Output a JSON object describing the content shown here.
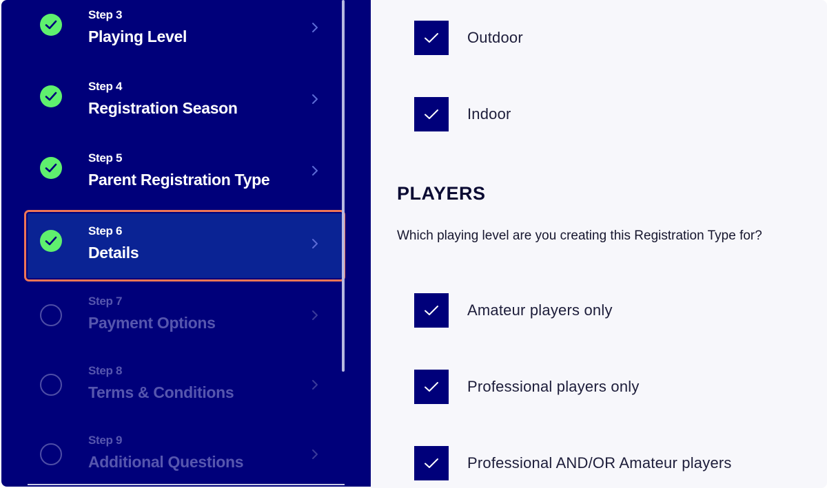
{
  "sidebar": {
    "steps": [
      {
        "num": "Step 3",
        "title": "Playing Level",
        "state": "done"
      },
      {
        "num": "Step 4",
        "title": "Registration Season",
        "state": "done"
      },
      {
        "num": "Step 5",
        "title": "Parent Registration Type",
        "state": "done"
      },
      {
        "num": "Step 6",
        "title": "Details",
        "state": "active"
      },
      {
        "num": "Step 7",
        "title": "Payment Options",
        "state": "pending"
      },
      {
        "num": "Step 8",
        "title": "Terms & Conditions",
        "state": "pending"
      },
      {
        "num": "Step 9",
        "title": "Additional Questions",
        "state": "pending"
      }
    ]
  },
  "main": {
    "environment_options": [
      {
        "label": "Outdoor",
        "checked": true
      },
      {
        "label": "Indoor",
        "checked": true
      }
    ],
    "players_section": {
      "title": "PLAYERS",
      "question": "Which playing level are you creating this Registration Type for?",
      "options": [
        {
          "label": "Amateur players only",
          "checked": true
        },
        {
          "label": "Professional players only",
          "checked": true
        },
        {
          "label": "Professional AND/OR Amateur players",
          "checked": true
        }
      ]
    }
  },
  "colors": {
    "sidebar_bg": "#00007a",
    "active_step_bg": "#0a2394",
    "active_outline": "#ef7556",
    "done_green": "#5ff06e",
    "checkbox_bg": "#00007a",
    "main_bg": "#f7f7fb"
  },
  "icons": {
    "done": "check-circle-icon",
    "pending": "empty-circle-icon",
    "chevron": "chevron-right-icon",
    "checkbox": "checkmark-icon"
  }
}
